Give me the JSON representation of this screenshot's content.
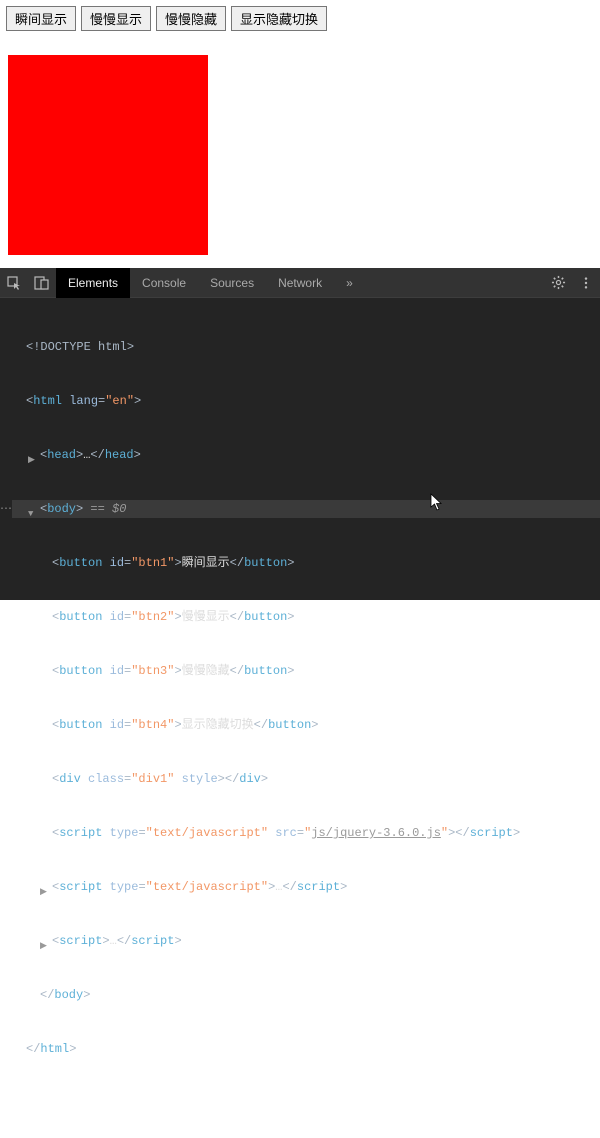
{
  "buttons": {
    "btn1": "瞬间显示",
    "btn2": "慢慢显示",
    "btn3": "慢慢隐藏",
    "btn4": "显示隐藏切换"
  },
  "redbox": {
    "color": "#ff0000"
  },
  "devtools": {
    "tabs": {
      "elements": "Elements",
      "console": "Console",
      "sources": "Sources",
      "network": "Network",
      "more": "»"
    },
    "code": {
      "doctype": "<!DOCTYPE html>",
      "html_open_tag": "html",
      "html_lang_attr": "lang",
      "html_lang_val": "\"en\"",
      "head_tag": "head",
      "ellipsis": "…",
      "body_tag": "body",
      "eq_dollar": " == $0",
      "button_tag": "button",
      "id_attr": "id",
      "btn1_id": "\"btn1\"",
      "btn1_text": "瞬间显示",
      "btn2_id": "\"btn2\"",
      "btn2_text": "慢慢显示",
      "btn3_id": "\"btn3\"",
      "btn3_text": "慢慢隐藏",
      "btn4_id": "\"btn4\"",
      "btn4_text": "显示隐藏切换",
      "div_tag": "div",
      "class_attr": "class",
      "div_class": "\"div1\"",
      "style_attr": "style",
      "script_tag": "script",
      "type_attr": "type",
      "type_val": "\"text/javascript\"",
      "src_attr": "src",
      "src_val": "js/jquery-3.6.0.js"
    }
  }
}
